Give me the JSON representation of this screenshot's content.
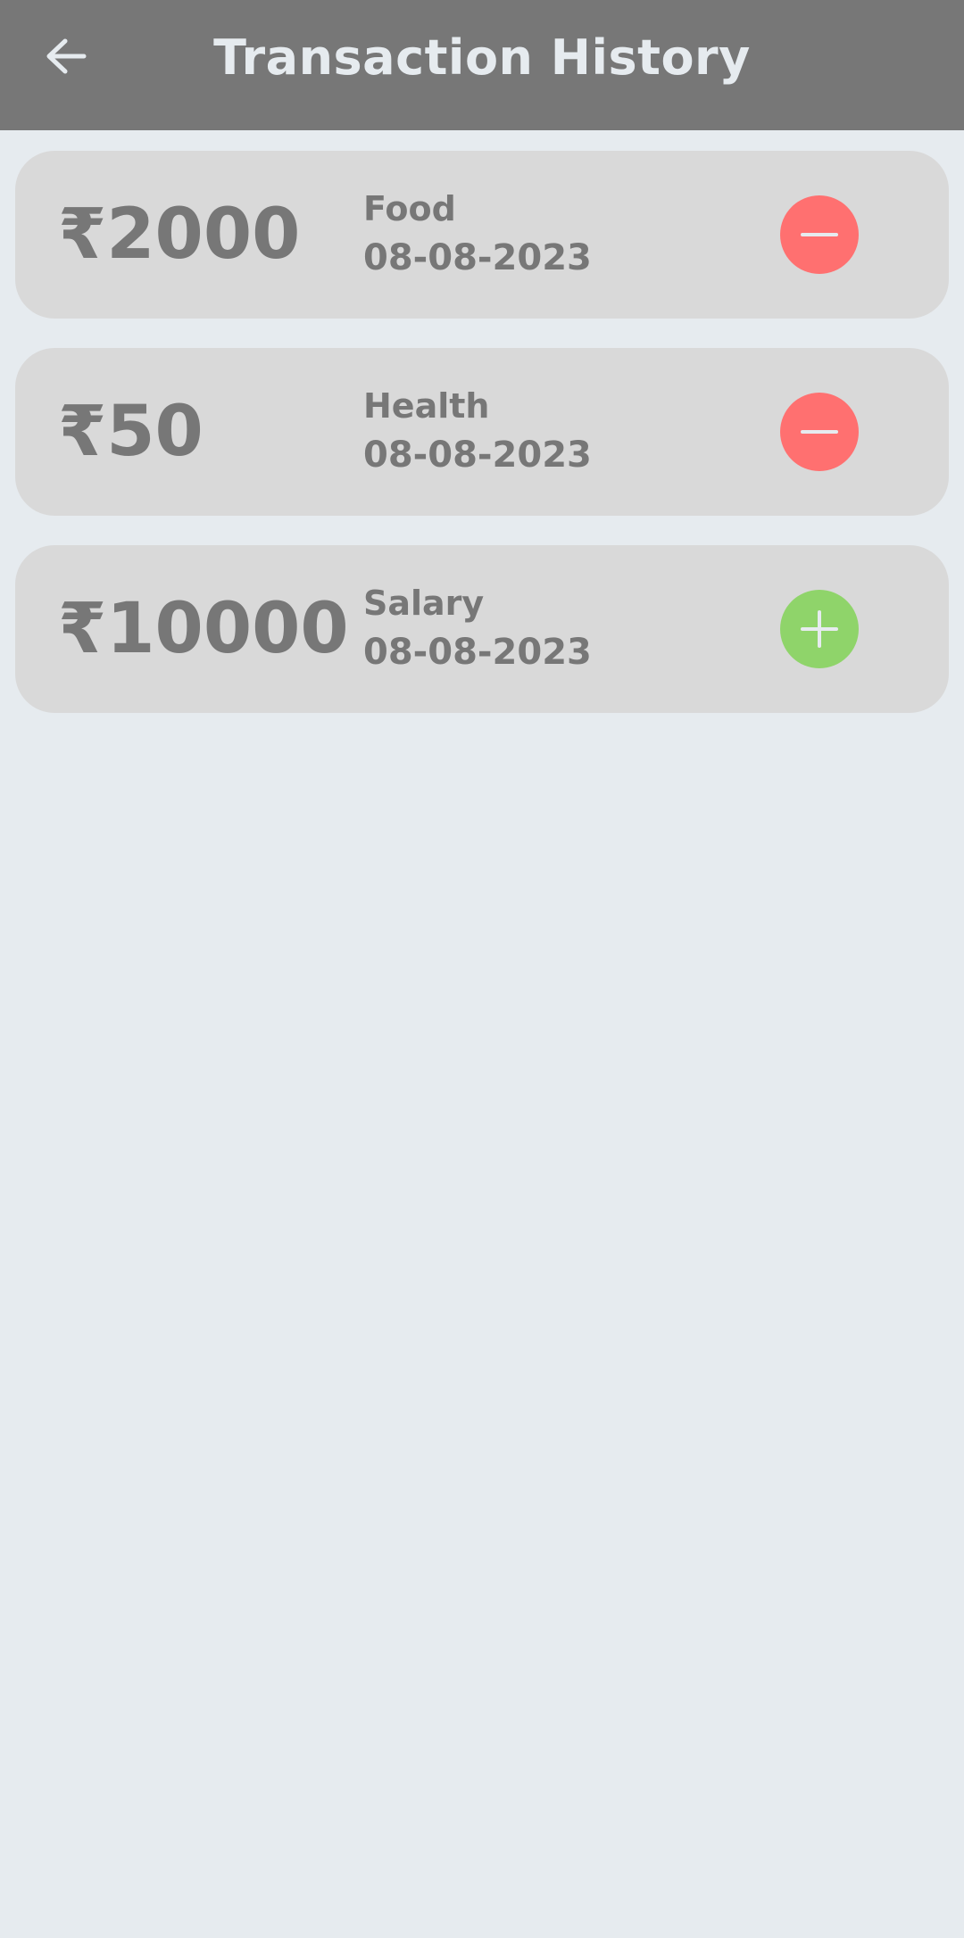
{
  "header": {
    "title": "Transaction History",
    "back_icon": "arrow-left-icon",
    "background": "#777777",
    "text_color": "#e6ebef"
  },
  "transactions": [
    {
      "amount": "₹2000",
      "category": "Food",
      "date": "08-08-2023",
      "type": "expense",
      "icon": "minus-icon",
      "badge_color": "#ff7070"
    },
    {
      "amount": "₹50",
      "category": "Health",
      "date": "08-08-2023",
      "type": "expense",
      "icon": "minus-icon",
      "badge_color": "#ff7070"
    },
    {
      "amount": "₹10000",
      "category": "Salary",
      "date": "08-08-2023",
      "type": "income",
      "icon": "plus-icon",
      "badge_color": "#8fd46a"
    }
  ],
  "colors": {
    "page_background": "#e6ebef",
    "card_background": "#d9d9d9",
    "card_text": "#777777"
  }
}
